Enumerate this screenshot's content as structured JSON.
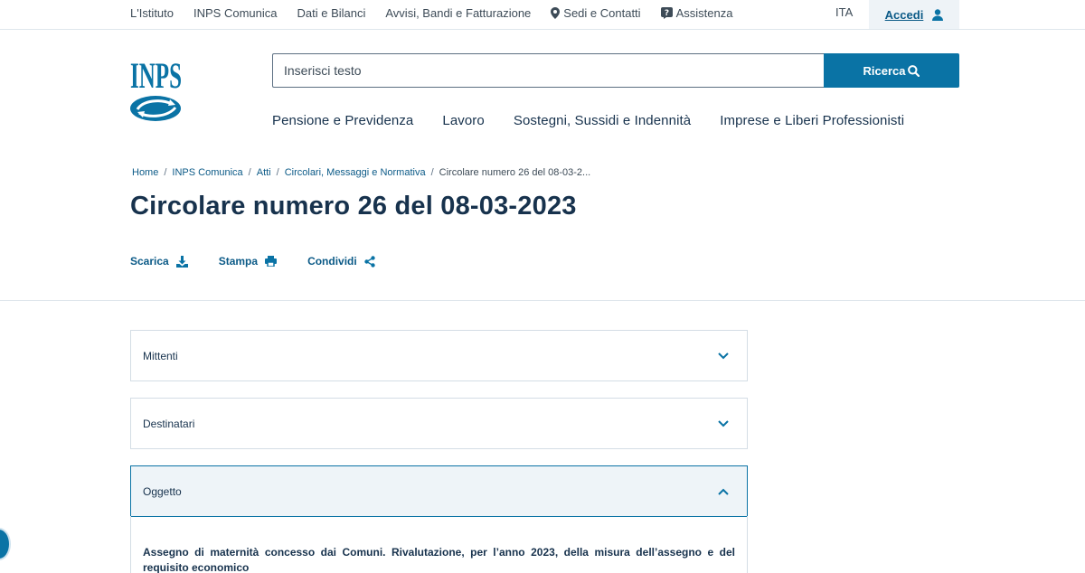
{
  "topbar": {
    "links": [
      "L'Istituto",
      "INPS Comunica",
      "Dati e Bilanci",
      "Avvisi, Bandi e Fatturazione",
      "Sedi e Contatti",
      "Assistenza"
    ],
    "lang": "ITA",
    "login_label": "Accedi"
  },
  "logo": {
    "text": "INPS"
  },
  "search": {
    "placeholder": "Inserisci testo",
    "button_label": "Ricerca"
  },
  "mainnav": [
    "Pensione e Previdenza",
    "Lavoro",
    "Sostegni, Sussidi e Indennità",
    "Imprese e Liberi Professionisti"
  ],
  "breadcrumb": [
    "Home",
    "INPS Comunica",
    "Atti",
    "Circolari, Messaggi e Normativa",
    "Circolare numero 26 del 08-03-2..."
  ],
  "title": "Circolare numero 26 del 08-03-2023",
  "actions": {
    "download": "Scarica",
    "print": "Stampa",
    "share": "Condividi"
  },
  "accordion": [
    {
      "label": "Mittenti",
      "open": false
    },
    {
      "label": "Destinatari",
      "open": false
    },
    {
      "label": "Oggetto",
      "open": true
    }
  ],
  "oggetto_text": "Assegno di maternità concesso dai Comuni. Rivalutazione, per l’anno 2023, della misura dell’assegno e del requisito economico",
  "colors": {
    "primary": "#0a73a5",
    "text": "#17324d",
    "link": "#0b5a87"
  }
}
